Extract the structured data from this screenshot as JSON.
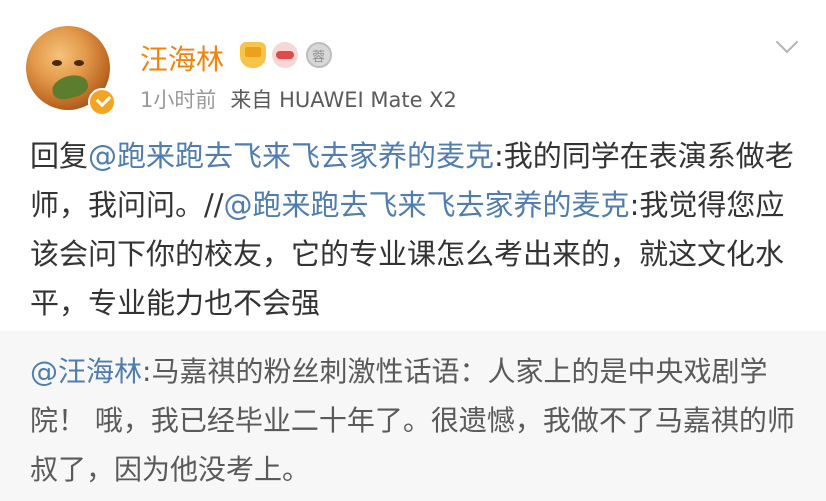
{
  "post": {
    "username": "汪海林",
    "time": "1小时前",
    "source_prefix": "来自",
    "device": "HUAWEI Mate X2",
    "badges": [
      "crown-badge",
      "bow-badge",
      "medal-badge"
    ],
    "medal_label": "蓉",
    "content": {
      "reply_prefix": "回复",
      "mention1": "@跑来跑去飞来飞去家养的麦克",
      "text1": ":我的同学在表演系做老师，我问问。//",
      "mention2": "@跑来跑去飞来飞去家养的麦克",
      "text2": ":我觉得您应该会问下你的校友，它的专业课怎么考出来的，就这文化水平，专业能力也不会强"
    }
  },
  "repost": {
    "mention": "@汪海林",
    "text": ":马嘉祺的粉丝刺激性话语：人家上的是中央戏剧学院！ 哦，我已经毕业二十年了。很遗憾，我做不了马嘉祺的师叔了，因为他没考上。"
  },
  "colors": {
    "username": "#f5820a",
    "mention": "#507daf",
    "text": "#333333",
    "meta": "#9a9a9a",
    "repost_bg": "#f7f7f7"
  },
  "icons": {
    "verified": "verified-v-icon",
    "menu": "chevron-down-icon"
  }
}
